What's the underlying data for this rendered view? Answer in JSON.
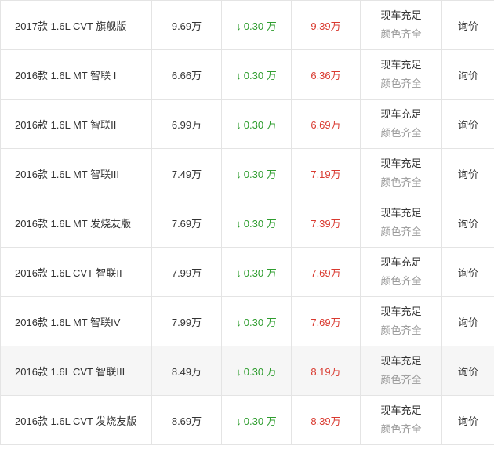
{
  "table": {
    "rows": [
      {
        "model": "2017款 1.6L CVT 旗舰版",
        "msrp": "9.69万",
        "discount": "0.30 万",
        "price": "9.39万",
        "stock": "现车充足",
        "color": "颜色齐全",
        "action": "询价"
      },
      {
        "model": "2016款 1.6L MT 智联 I",
        "msrp": "6.66万",
        "discount": "0.30 万",
        "price": "6.36万",
        "stock": "现车充足",
        "color": "颜色齐全",
        "action": "询价"
      },
      {
        "model": "2016款 1.6L MT 智联II",
        "msrp": "6.99万",
        "discount": "0.30 万",
        "price": "6.69万",
        "stock": "现车充足",
        "color": "颜色齐全",
        "action": "询价"
      },
      {
        "model": "2016款 1.6L MT 智联III",
        "msrp": "7.49万",
        "discount": "0.30 万",
        "price": "7.19万",
        "stock": "现车充足",
        "color": "颜色齐全",
        "action": "询价"
      },
      {
        "model": "2016款 1.6L MT 发烧友版",
        "msrp": "7.69万",
        "discount": "0.30 万",
        "price": "7.39万",
        "stock": "现车充足",
        "color": "颜色齐全",
        "action": "询价"
      },
      {
        "model": "2016款 1.6L CVT 智联II",
        "msrp": "7.99万",
        "discount": "0.30 万",
        "price": "7.69万",
        "stock": "现车充足",
        "color": "颜色齐全",
        "action": "询价"
      },
      {
        "model": "2016款 1.6L MT 智联IV",
        "msrp": "7.99万",
        "discount": "0.30 万",
        "price": "7.69万",
        "stock": "现车充足",
        "color": "颜色齐全",
        "action": "询价"
      },
      {
        "model": "2016款 1.6L CVT 智联III",
        "msrp": "8.49万",
        "discount": "0.30 万",
        "price": "8.19万",
        "stock": "现车充足",
        "color": "颜色齐全",
        "action": "询价"
      },
      {
        "model": "2016款 1.6L CVT 发烧友版",
        "msrp": "8.69万",
        "discount": "0.30 万",
        "price": "8.39万",
        "stock": "现车充足",
        "color": "颜色齐全",
        "action": "询价"
      }
    ],
    "discount_arrow": "↓",
    "highlighted_row": 7,
    "colors": {
      "discount": "#2f9d2f",
      "price": "#d93a30",
      "border": "#e4e4e4",
      "muted_text": "#999999",
      "highlight_bg": "#f6f6f6"
    }
  }
}
